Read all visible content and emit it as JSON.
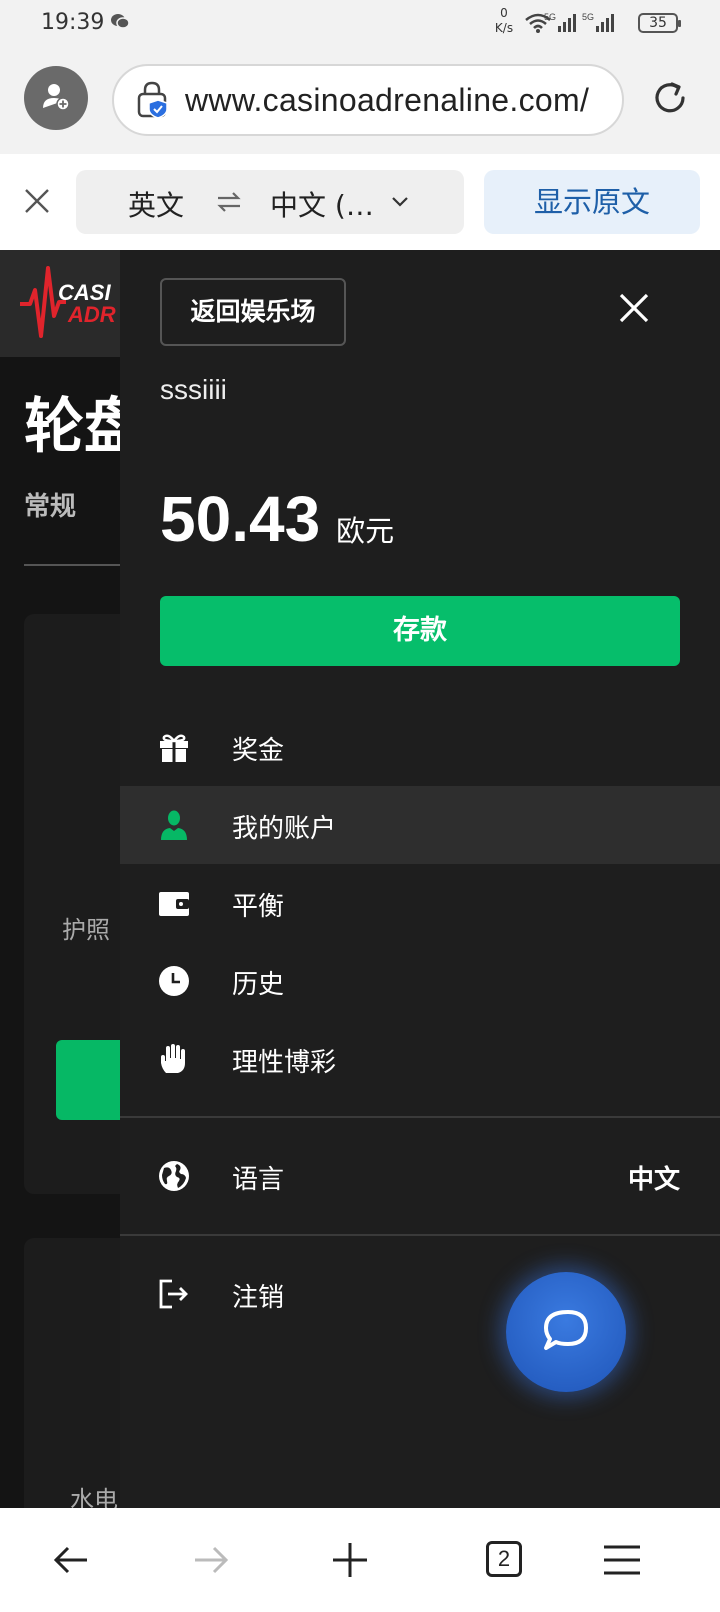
{
  "status_bar": {
    "time": "19:39",
    "speed_value": "0",
    "speed_unit": "K/s",
    "battery": "35",
    "icons": [
      "wechat-icon",
      "wifi-icon",
      "signal-5g-icon",
      "signal-5g-icon",
      "battery-icon"
    ]
  },
  "browser": {
    "url": "www.casinoadrenaline.com/",
    "tab_count": "2"
  },
  "translate_bar": {
    "source_lang": "英文",
    "target_lang": "中文 (…",
    "show_original_label": "显示原文"
  },
  "page": {
    "title": "轮盘",
    "tab_label": "常规",
    "card_label": "护照",
    "card2_label": "水电"
  },
  "drawer": {
    "back_label": "返回娱乐场",
    "username": "sssiiii",
    "balance_amount": "50.43",
    "balance_currency": "欧元",
    "deposit_label": "存款",
    "menu": [
      {
        "label": "奖金",
        "icon": "gift-icon",
        "active": false
      },
      {
        "label": "我的账户",
        "icon": "user-icon",
        "active": true
      },
      {
        "label": "平衡",
        "icon": "wallet-icon",
        "active": false
      },
      {
        "label": "历史",
        "icon": "clock-icon",
        "active": false
      },
      {
        "label": "理性博彩",
        "icon": "hand-icon",
        "active": false
      }
    ],
    "language_label": "语言",
    "language_value": "中文",
    "logout_label": "注销"
  },
  "colors": {
    "accent_green": "#06be6b",
    "active_user_icon": "#06b865",
    "chat_blue": "#2a66cc",
    "drawer_bg": "#1e1e1e",
    "translate_blue": "#1e5fa8"
  }
}
